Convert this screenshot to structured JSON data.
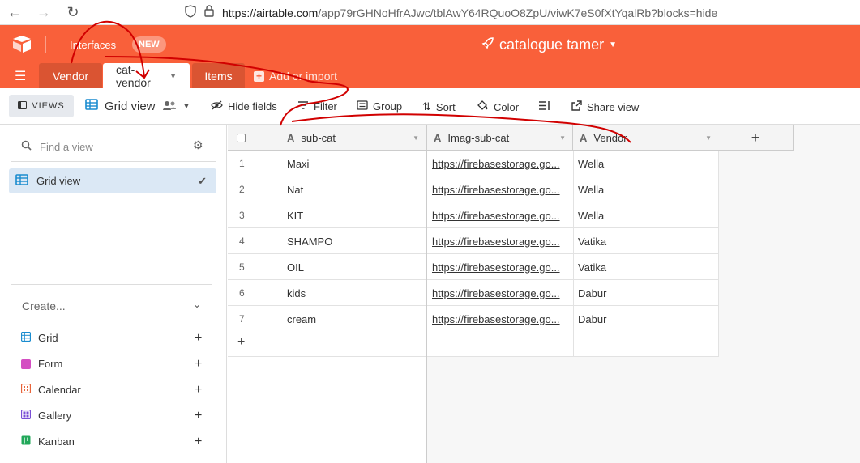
{
  "browser": {
    "url_host": "https://airtable.com",
    "url_rest": "/app79rGHNoHfrAJwc/tblAwY64RQuoO8ZpU/viwK7eS0fXtYqalRb?blocks=hide"
  },
  "header": {
    "interfaces_label": "Interfaces",
    "new_badge": "NEW",
    "base_title": "catalogue tamer",
    "brand_color": "#f9603a"
  },
  "tabs": {
    "items": [
      {
        "label": "Vendor"
      },
      {
        "label": "cat-vendor"
      },
      {
        "label": "Items"
      }
    ],
    "add_import": "Add or import"
  },
  "toolbar": {
    "views_label": "VIEWS",
    "view_name": "Grid view",
    "hide_fields": "Hide fields",
    "filter": "Filter",
    "group": "Group",
    "sort": "Sort",
    "color": "Color",
    "share_view": "Share view"
  },
  "sidebar": {
    "find_placeholder": "Find a view",
    "active_view": "Grid view",
    "create_label": "Create...",
    "create_items": [
      {
        "label": "Grid",
        "color": "#1a8ccf"
      },
      {
        "label": "Form",
        "color": "#d44ec2"
      },
      {
        "label": "Calendar",
        "color": "#e8643a"
      },
      {
        "label": "Gallery",
        "color": "#7a4fd6"
      },
      {
        "label": "Kanban",
        "color": "#22a85a"
      }
    ]
  },
  "grid": {
    "columns": [
      "sub-cat",
      "Imag-sub-cat",
      "Vendor"
    ],
    "rows": [
      {
        "num": "1",
        "sub_cat": "Maxi",
        "img": "https://firebasestorage.go...",
        "vendor": "Wella"
      },
      {
        "num": "2",
        "sub_cat": "Nat",
        "img": "https://firebasestorage.go...",
        "vendor": "Wella"
      },
      {
        "num": "3",
        "sub_cat": "KIT",
        "img": "https://firebasestorage.go...",
        "vendor": "Wella"
      },
      {
        "num": "4",
        "sub_cat": "SHAMPO",
        "img": "https://firebasestorage.go...",
        "vendor": "Vatika"
      },
      {
        "num": "5",
        "sub_cat": "OIL",
        "img": "https://firebasestorage.go...",
        "vendor": "Vatika"
      },
      {
        "num": "6",
        "sub_cat": "kids",
        "img": "https://firebasestorage.go...",
        "vendor": "Dabur"
      },
      {
        "num": "7",
        "sub_cat": "cream",
        "img": "https://firebasestorage.go...",
        "vendor": "Dabur"
      }
    ]
  }
}
